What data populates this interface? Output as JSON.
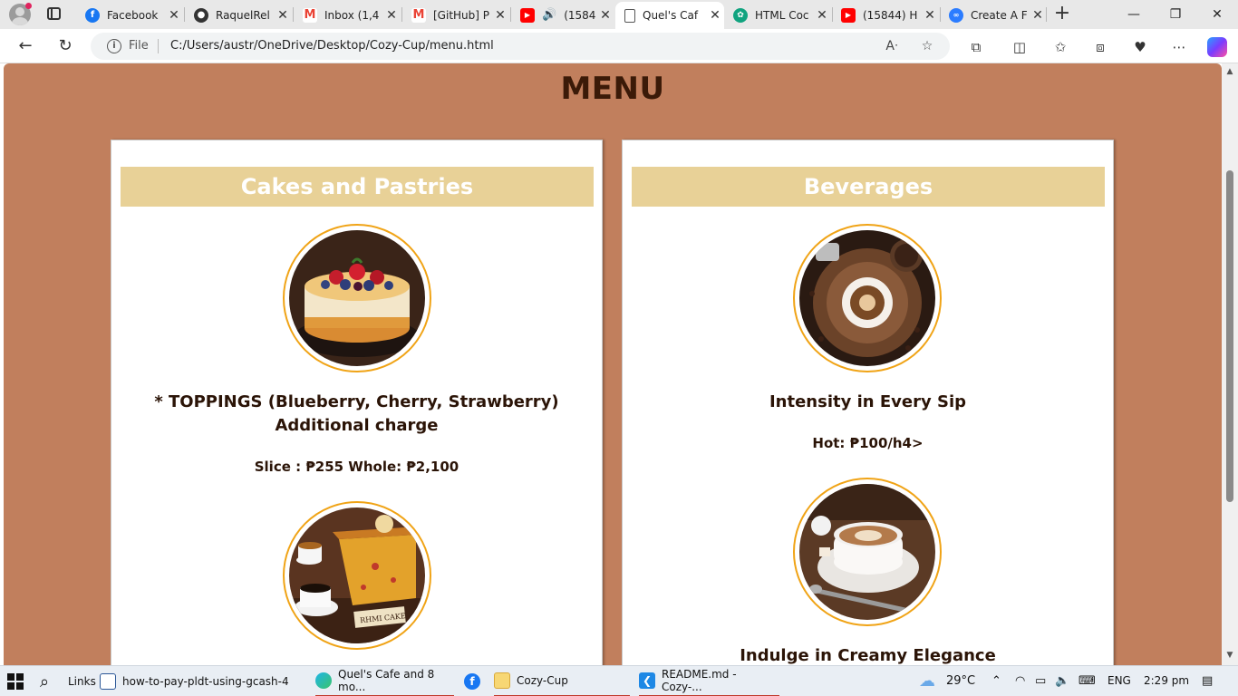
{
  "browser": {
    "tabs": [
      {
        "title": "Facebook",
        "icon": "facebook-icon",
        "color": "#1877f2",
        "active": false
      },
      {
        "title": "RaquelRel",
        "icon": "github-icon",
        "color": "#333333",
        "active": false
      },
      {
        "title": "Inbox (1,4",
        "icon": "gmail-icon",
        "color": "#ea4335",
        "active": false
      },
      {
        "title": "[GitHub] P",
        "icon": "gmail-icon",
        "color": "#ea4335",
        "active": false
      },
      {
        "title": "(1584",
        "icon": "youtube-icon",
        "color": "#ff0000",
        "active": false
      },
      {
        "title": "Quel's Caf",
        "icon": "page-icon",
        "color": "#555555",
        "active": true
      },
      {
        "title": "HTML Coc",
        "icon": "chatgpt-icon",
        "color": "#10a37f",
        "active": false
      },
      {
        "title": "(15844) H",
        "icon": "youtube-icon",
        "color": "#ff0000",
        "active": false
      },
      {
        "title": "Create A F",
        "icon": "codepen-icon",
        "color": "#2b7cff",
        "active": false
      }
    ],
    "address": {
      "scheme_label": "File",
      "url": "C:/Users/austr/OneDrive/Desktop/Cozy-Cup/menu.html"
    }
  },
  "page": {
    "title": "MENU",
    "colors": {
      "background": "#c17f5d",
      "section_header": "#e8d197",
      "photo_ring": "#f0a315",
      "text": "#2b1407"
    },
    "sections": [
      {
        "heading": "Cakes and Pastries",
        "items": [
          {
            "name": "* TOPPINGS (Blueberry, Cherry, Strawberry) Additional charge",
            "price": "Slice : ₱255 Whole: ₱2,100",
            "image": "berry-cheesecake"
          },
          {
            "name": "",
            "price": "",
            "image": "rhm-cake-with-coffee",
            "label_on_image": "RHMI CAKE"
          }
        ]
      },
      {
        "heading": "Beverages",
        "items": [
          {
            "name": "Intensity in Every Sip",
            "price": "Hot: ₱100/h4>",
            "image": "espresso-with-beans"
          },
          {
            "name": "Indulge in Creamy Elegance",
            "price": "",
            "image": "cappuccino-cup"
          }
        ]
      }
    ]
  },
  "taskbar": {
    "items": [
      {
        "label": "Links",
        "icon": "links-icon"
      },
      {
        "label": "how-to-pay-pldt-using-gcash-4",
        "icon": "file-icon"
      },
      {
        "label": "Quel's Cafe and 8 mo...",
        "icon": "edge-icon"
      },
      {
        "label": "",
        "icon": "facebook-icon"
      },
      {
        "label": "Cozy-Cup",
        "icon": "folder-icon"
      },
      {
        "label": "README.md - Cozy-...",
        "icon": "vscode-icon"
      }
    ],
    "weather": "29°C",
    "language": "ENG",
    "time": "2:29 pm"
  }
}
